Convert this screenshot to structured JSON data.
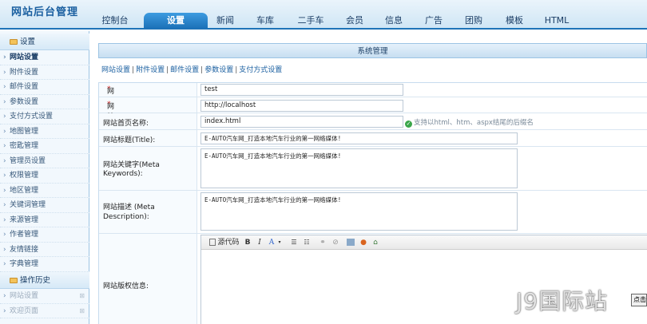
{
  "app": {
    "title": "网站后台管理"
  },
  "nav": [
    "控制台",
    "设置",
    "新闻",
    "车库",
    "二手车",
    "会员",
    "信息",
    "广告",
    "团购",
    "模板",
    "HTML"
  ],
  "nav_active": "设置",
  "sidebar": {
    "group1": "设置",
    "items": [
      "网站设置",
      "附件设置",
      "邮件设置",
      "参数设置",
      "支付方式设置",
      "地图管理",
      "密匙管理",
      "管理员设置",
      "权限管理",
      "地区管理",
      "关键词管理",
      "来源管理",
      "作者管理",
      "友情链接",
      "字典管理"
    ],
    "active_item": "网站设置",
    "group2": "操作历史",
    "history": [
      "网站设置",
      "欢迎页面"
    ]
  },
  "main": {
    "title": "系统管理",
    "tabs": [
      "网站设置",
      "附件设置",
      "邮件设置",
      "参数设置",
      "支付方式设置"
    ],
    "tab_sep": "|",
    "form": {
      "site_name": {
        "label": "网站名称:",
        "value": "test"
      },
      "site_url": {
        "label": "网站地址:",
        "value": "http://localhost"
      },
      "home_name": {
        "label": "网站首页名称:",
        "value": "index.html",
        "hint": "支持以html、htm、aspx结尾的后缀名"
      },
      "site_title": {
        "label": "网站标题(Title):",
        "value": "E-AUTO汽车网_打造本地汽车行业的第一网络媒体!"
      },
      "keywords": {
        "label1": "网站关键字(Meta",
        "label2": "Keywords):",
        "value": "E-AUTO汽车网_打造本地汽车行业的第一网络媒体!"
      },
      "description": {
        "label1": "网站描述 (Meta",
        "label2": "Description):",
        "value": "E-AUTO汽车网_打造本地汽车行业的第一网络媒体!"
      },
      "copyright": {
        "label": "网站版权信息:"
      }
    },
    "editor": {
      "source_label": "源代码",
      "bold": "B",
      "italic": "I",
      "font": "A"
    }
  },
  "required_mark": "*",
  "watermark": "J9国际站",
  "clipped_button": "点击"
}
